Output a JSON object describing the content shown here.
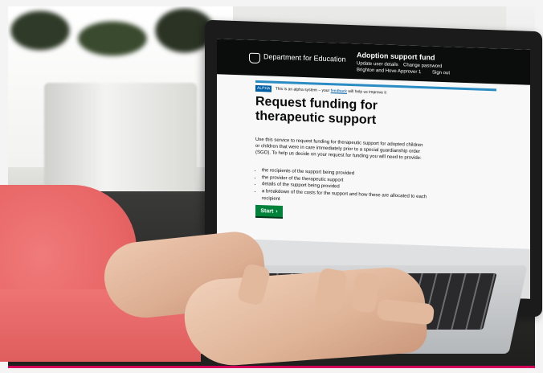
{
  "photo": {
    "description_alt": "",
    "screen": {
      "header": {
        "department": "Department for Education",
        "service": "Adoption support fund",
        "links": [
          "Update user details",
          "Change password",
          "Brighton and Hove Approver 1",
          "Sign out"
        ]
      },
      "phase_banner": {
        "tag": "ALPHA",
        "text_before": "This is an alpha system – your",
        "link": "feedback",
        "text_after": "will help us improve it"
      },
      "heading": "Request funding for therapeutic support",
      "intro": "Use this service to request funding for therapeutic support for adopted children or children that were in care immediately prior to a special guardianship order (SGO). To help us decide on your request for funding you will need to provide:",
      "bullets": [
        "the recipients of the support being provided",
        "the provider of the therapeutic support",
        "details of the support being provided",
        "a breakdown of the costs for the support and how these are allocated to each recipient"
      ],
      "start_button": "Start"
    },
    "colors": {
      "header_bg": "#0b0c0c",
      "alpha_tag": "#005ea5",
      "start_button": "#00823b",
      "sleeve": "#e86565",
      "frame_accent": "#d4005a"
    }
  }
}
